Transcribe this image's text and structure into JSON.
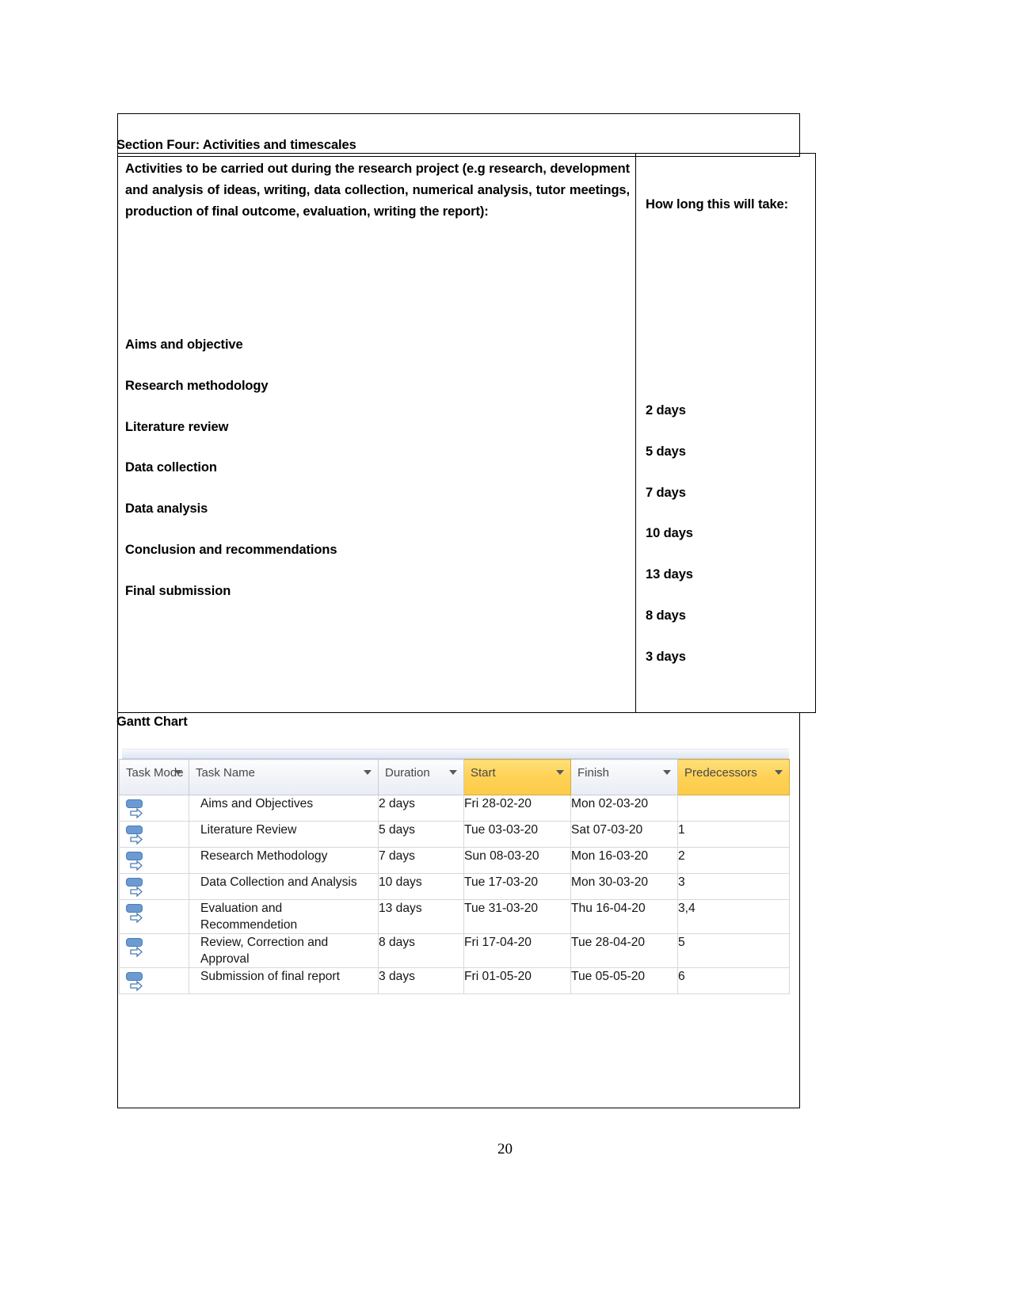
{
  "section": {
    "title": "Section Four: Activities and timescales",
    "intro": "Activities to be carried out during the research project (e.g research, development and analysis of ideas, writing, data collection, numerical analysis, tutor meetings, production of final outcome, evaluation, writing the report):",
    "how_long_label": "How long this will take:",
    "activities": [
      "Aims and objective",
      "Research methodology",
      "Literature review",
      "Data collection",
      "Data analysis",
      "Conclusion and recommendations",
      "Final submission"
    ],
    "durations": [
      "2 days",
      "5 days",
      "7 days",
      "10 days",
      "13 days",
      "8 days",
      "3 days"
    ]
  },
  "gantt": {
    "title": "Gantt Chart",
    "columns": [
      {
        "label": "Task Mode",
        "highlight": false,
        "has_arrow": true
      },
      {
        "label": "Task Name",
        "highlight": false,
        "has_arrow": true
      },
      {
        "label": "Duration",
        "highlight": false,
        "has_arrow": true
      },
      {
        "label": "Start",
        "highlight": true,
        "has_arrow": true
      },
      {
        "label": "Finish",
        "highlight": false,
        "has_arrow": true
      },
      {
        "label": "Predecessors",
        "highlight": true,
        "has_arrow": true
      }
    ],
    "rows": [
      {
        "mode_icon": "manually-scheduled-icon",
        "name": "Aims and Objectives",
        "duration": "2 days",
        "start": "Fri 28-02-20",
        "finish": "Mon 02-03-20",
        "predecessors": ""
      },
      {
        "mode_icon": "manually-scheduled-icon",
        "name": "Literature Review",
        "duration": "5 days",
        "start": "Tue 03-03-20",
        "finish": "Sat 07-03-20",
        "predecessors": "1"
      },
      {
        "mode_icon": "manually-scheduled-icon",
        "name": "Research Methodology",
        "duration": "7 days",
        "start": "Sun 08-03-20",
        "finish": "Mon 16-03-20",
        "predecessors": "2"
      },
      {
        "mode_icon": "manually-scheduled-icon",
        "name": "Data Collection and Analysis",
        "duration": "10 days",
        "start": "Tue 17-03-20",
        "finish": "Mon 30-03-20",
        "predecessors": "3"
      },
      {
        "mode_icon": "manually-scheduled-icon",
        "name": "Evaluation and Recommendetion",
        "duration": "13 days",
        "start": "Tue 31-03-20",
        "finish": "Thu 16-04-20",
        "predecessors": "3,4"
      },
      {
        "mode_icon": "manually-scheduled-icon",
        "name": "Review, Correction and Approval",
        "duration": "8 days",
        "start": "Fri 17-04-20",
        "finish": "Tue 28-04-20",
        "predecessors": "5"
      },
      {
        "mode_icon": "manually-scheduled-icon",
        "name": "Submission of final report",
        "duration": "3 days",
        "start": "Fri 01-05-20",
        "finish": "Tue 05-05-20",
        "predecessors": "6"
      }
    ],
    "selected_row_index": 6,
    "selected_cells": [
      "duration",
      "finish"
    ],
    "colors": {
      "header_highlight": "#ffd257",
      "selection_shade": "#e4edf7",
      "task_mode_icon": "#6b9bd2"
    }
  },
  "page_number": "20"
}
